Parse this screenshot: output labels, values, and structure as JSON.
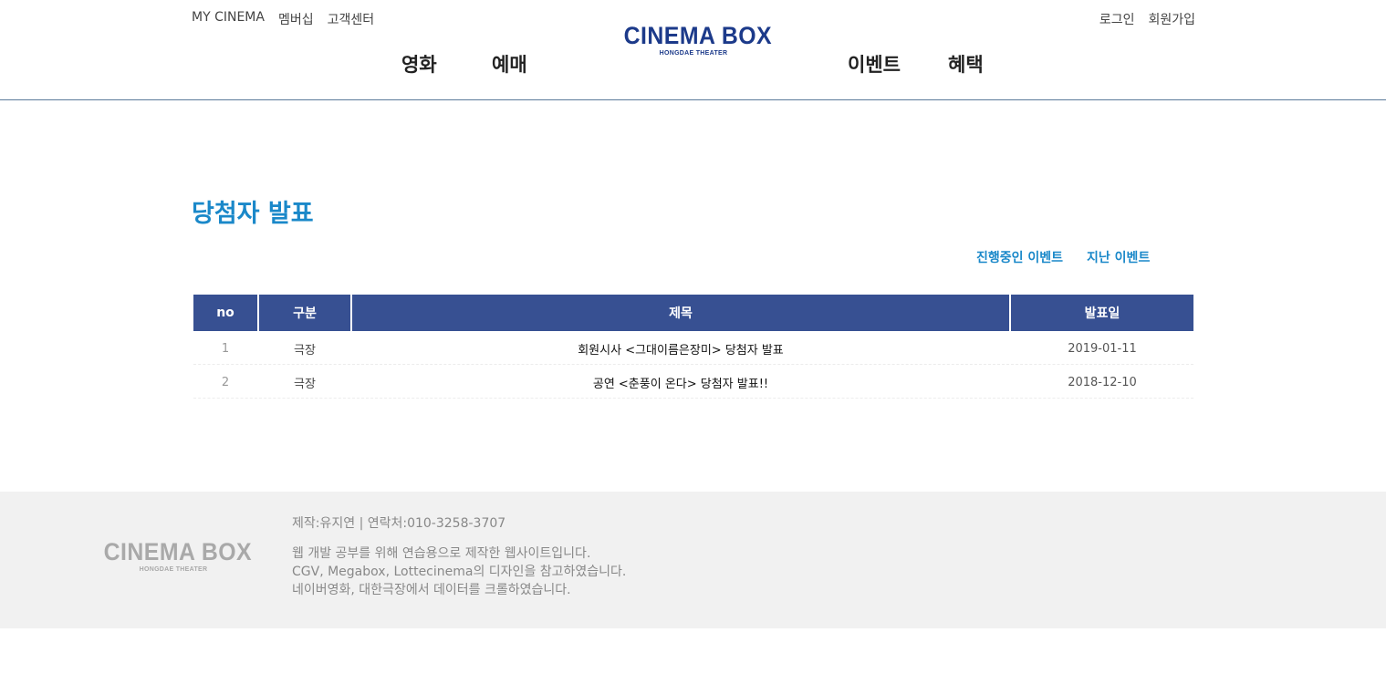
{
  "header": {
    "util_left": [
      "MY CINEMA",
      "멤버십",
      "고객센터"
    ],
    "util_right": [
      "로그인",
      "회원가입"
    ],
    "logo_main": "CINEMA BOX",
    "logo_sub": "HONGDAE THEATER",
    "nav": [
      "영화",
      "예매",
      "이벤트",
      "혜택"
    ]
  },
  "main": {
    "title": "당첨자 발표",
    "tabs": [
      "진행중인 이벤트",
      "지난 이벤트"
    ],
    "table": {
      "headers": [
        "no",
        "구분",
        "제목",
        "발표일"
      ],
      "rows": [
        [
          "1",
          "극장",
          "회원시사 <그대이름은장미> 당첨자 발표",
          "2019-01-11"
        ],
        [
          "2",
          "극장",
          "공연 <춘풍이 온다> 당첨자 발표!!",
          "2018-12-10"
        ]
      ]
    }
  },
  "footer": {
    "logo_main": "CINEMA BOX",
    "logo_sub": "HONGDAE THEATER",
    "contact": "제작:유지연 | 연락처:010-3258-3707",
    "desc": [
      "웹 개발 공부를 위해 연습용으로 제작한 웹사이트입니다.",
      "CGV, Megabox, Lottecinema의 디자인을 참고하였습니다.",
      "네이버영화, 대한극장에서 데이터를 크롤하였습니다."
    ]
  },
  "colors": {
    "brand": "#1c3a8a",
    "title_blue": "#1a88c9",
    "table_header": "#375092",
    "footer_bg": "#f1f1f1"
  }
}
